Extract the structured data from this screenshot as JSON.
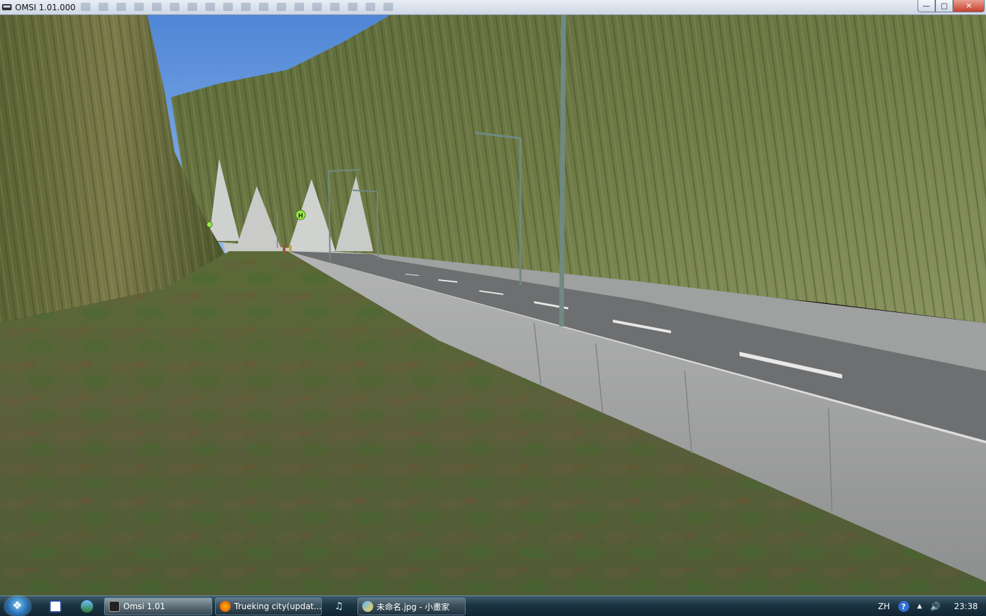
{
  "window": {
    "title": "OMSI 1.01.000",
    "controls": {
      "minimize": "—",
      "maximize": "▢",
      "close": "✕"
    }
  },
  "scene": {
    "stop_sign_label": "H",
    "colors": {
      "sky": "#5b8fd8",
      "grass": "#5e6b3c",
      "cliff": "#6f7a45",
      "road": "#6e7070",
      "barrier": "#a2a3a3",
      "pole": "#6f8a82",
      "stop_sign": "#9ee84a"
    }
  },
  "taskbar": {
    "items": [
      {
        "label": "Omsi 1.01",
        "icon": "omsi-icon",
        "active": true
      },
      {
        "label": "Trueking city(updat...",
        "icon": "firefox-icon",
        "active": false
      },
      {
        "label": "未命名.jpg - 小畫家",
        "icon": "paint-icon",
        "active": false
      }
    ],
    "media_icon": "♫",
    "tray": {
      "language": "ZH",
      "help": "?",
      "arrows": "▲",
      "volume": "🔊",
      "clock": "23:38"
    }
  }
}
